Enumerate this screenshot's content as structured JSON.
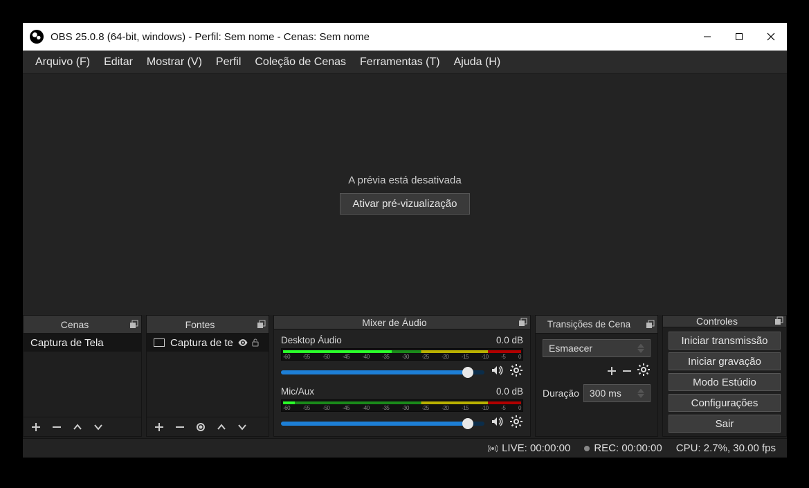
{
  "titlebar": {
    "title": "OBS 25.0.8 (64-bit, windows) - Perfil: Sem nome - Cenas: Sem nome"
  },
  "menu": {
    "items": [
      "Arquivo (F)",
      "Editar",
      "Mostrar (V)",
      "Perfil",
      "Coleção de Cenas",
      "Ferramentas (T)",
      "Ajuda (H)"
    ]
  },
  "preview": {
    "message": "A prévia está desativada",
    "button": "Ativar pré-vizualização"
  },
  "docks": {
    "scenes": {
      "title": "Cenas",
      "items": [
        "Captura de Tela"
      ]
    },
    "sources": {
      "title": "Fontes",
      "items": [
        {
          "label": "Captura de te",
          "visible": true,
          "locked": false
        }
      ]
    },
    "mixer": {
      "title": "Mixer de Áudio",
      "channels": [
        {
          "name": "Desktop Áudio",
          "db": "0.0 dB",
          "ticks": [
            "-60",
            "-55",
            "-50",
            "-45",
            "-40",
            "-35",
            "-30",
            "-25",
            "-20",
            "-15",
            "-10",
            "-5",
            "0"
          ]
        },
        {
          "name": "Mic/Aux",
          "db": "0.0 dB",
          "ticks": [
            "-60",
            "-55",
            "-50",
            "-45",
            "-40",
            "-35",
            "-30",
            "-25",
            "-20",
            "-15",
            "-10",
            "-5",
            "0"
          ]
        }
      ]
    },
    "transitions": {
      "title": "Transições de Cena",
      "selected": "Esmaecer",
      "duration_label": "Duração",
      "duration_value": "300 ms"
    },
    "controls": {
      "title": "Controles",
      "buttons": [
        "Iniciar transmissão",
        "Iniciar gravação",
        "Modo Estúdio",
        "Configurações",
        "Sair"
      ]
    }
  },
  "status": {
    "live": "LIVE: 00:00:00",
    "rec": "REC: 00:00:00",
    "cpu": "CPU: 2.7%, 30.00 fps"
  }
}
